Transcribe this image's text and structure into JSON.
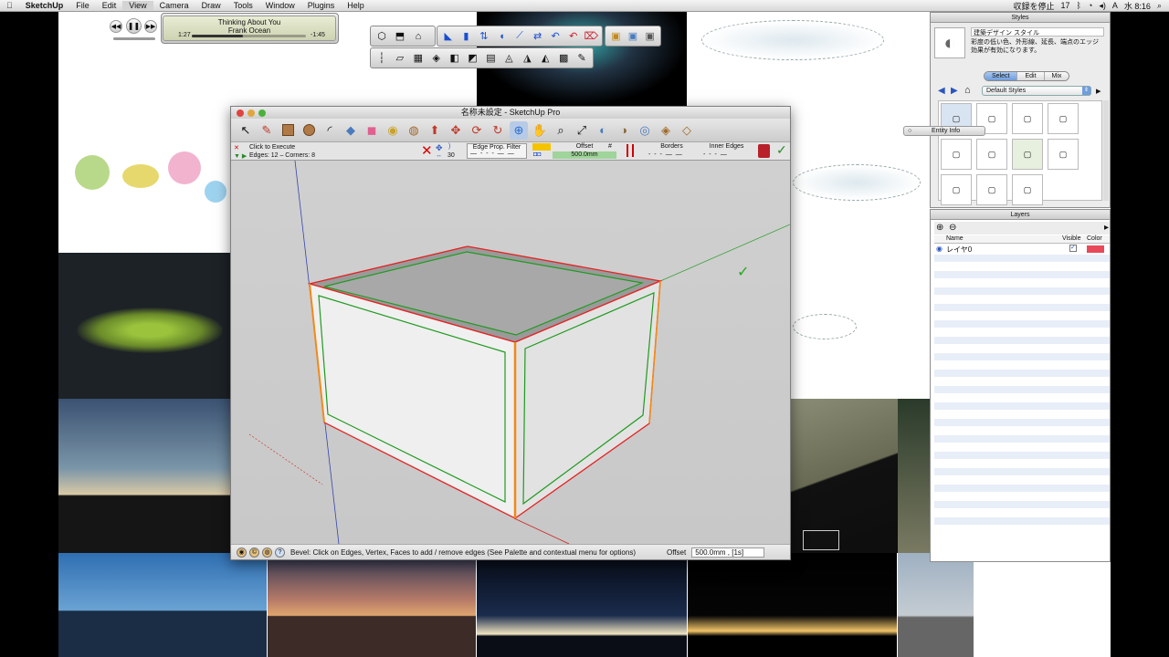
{
  "menubar": {
    "app": "SketchUp",
    "items": [
      "File",
      "Edit",
      "View",
      "Camera",
      "Draw",
      "Tools",
      "Window",
      "Plugins",
      "Help"
    ],
    "right": [
      "収録を停止",
      "17",
      "A",
      "水 8:16"
    ]
  },
  "itunes": {
    "track": "Thinking About You",
    "artist": "Frank Ocean",
    "elapsed": "1:27",
    "remaining": "-1:45",
    "progress": 0.45
  },
  "sketchup": {
    "title": "名称未設定 - SketchUp Pro",
    "bevel": {
      "click_to_execute": "Click to Execute",
      "edges_corners": "Edges: 12 – Corners: 8",
      "counter": "30",
      "edge_filter": "Edge Prop. Filter",
      "offset_label": "Offset",
      "offset_value": "500.0mm",
      "hash": "#",
      "borders": "Borders",
      "inner_edges": "Inner Edges"
    },
    "status": {
      "hint": "Bevel: Click on Edges, Vertex, Faces to add / remove edges (See Palette and contextual menu for options)",
      "vcb_label": "Offset",
      "vcb_value": "500.0mm , [1s]"
    },
    "checkmark": "✓"
  },
  "styles_panel": {
    "title": "Styles",
    "style_name": "建築デザイン スタイル",
    "style_desc": "彩度の低い色、外形線、延長、端点のエッジ効果が有効になります。",
    "tabs": [
      "Select",
      "Edit",
      "Mix"
    ],
    "active_tab": "Select",
    "dropdown": "Default Styles"
  },
  "entity_info": {
    "title": "Entity Info"
  },
  "layers_panel": {
    "title": "Layers",
    "columns": {
      "name": "Name",
      "visible": "Visible",
      "color": "Color"
    },
    "layers": [
      {
        "name": "レイヤ0",
        "visible": true,
        "color": "#e8495a"
      }
    ]
  }
}
